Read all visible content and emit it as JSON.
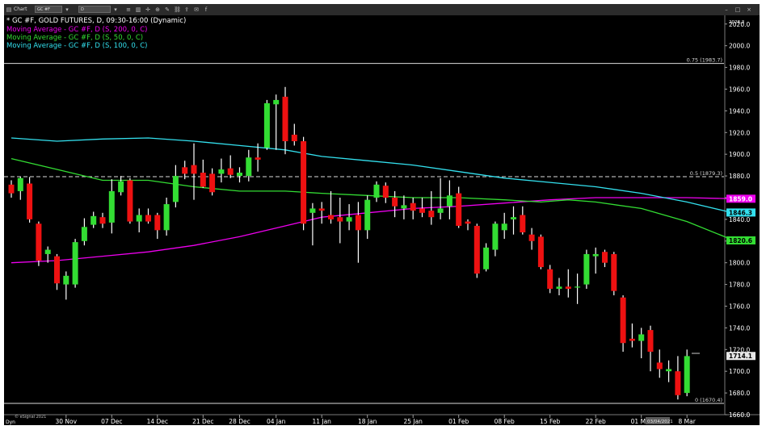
{
  "window": {
    "tab_label": "Chart",
    "symbol_field": "GC #F",
    "interval_field": "D"
  },
  "legend": {
    "main": "* GC #F, GOLD FUTURES, D, 09:30-16:00 (Dynamic)",
    "ma200": "Moving Average - GC #F, D (S, 200, 0, C)",
    "ma50": "Moving Average - GC #F, D (S, 50, 0, C)",
    "ma100": "Moving Average - GC #F, D (S, 100, 0, C)"
  },
  "footer": {
    "copyright": "© eSignal 2021",
    "dyn_label": "Dyn",
    "cursor_date": "03/04/2021"
  },
  "fib_labels": {
    "top": "0.75 (1983.7)",
    "mid": "0.5 (1879.3)",
    "bottom": "0 (1670.4)"
  },
  "price_tags": {
    "ma200": "1859.0",
    "ma100": "1846.3",
    "ma50": "1820.6",
    "last": "1714.1"
  },
  "colors": {
    "background": "#000000",
    "up_candle": "#33dd33",
    "down_candle": "#ee1111",
    "ma200": "#ee00ee",
    "ma50": "#33dd33",
    "ma100": "#33e0ee",
    "fib_line": "#dddddd",
    "axis_text": "#ffffff"
  },
  "chart_data": {
    "type": "candlestick",
    "title": "* GC #F, GOLD FUTURES, D, 09:30-16:00 (Dynamic)",
    "y_axis": {
      "min": 1660,
      "max": 2028,
      "ticks": [
        2020.0,
        2000.0,
        1980.0,
        1960.0,
        1940.0,
        1920.0,
        1900.0,
        1880.0,
        1860.0,
        1840.0,
        1820.0,
        1800.0,
        1780.0,
        1760.0,
        1740.0,
        1720.0,
        1700.0,
        1680.0,
        1660.0
      ],
      "top_label": "2028.3"
    },
    "x_ticks": [
      {
        "label": "30 Nov",
        "bar": 6
      },
      {
        "label": "07 Dec",
        "bar": 11
      },
      {
        "label": "14 Dec",
        "bar": 16
      },
      {
        "label": "21 Dec",
        "bar": 21
      },
      {
        "label": "28 Dec",
        "bar": 25
      },
      {
        "label": "04 Jan",
        "bar": 29
      },
      {
        "label": "11 Jan",
        "bar": 34
      },
      {
        "label": "18 Jan",
        "bar": 39
      },
      {
        "label": "25 Jan",
        "bar": 44
      },
      {
        "label": "01 Feb",
        "bar": 49
      },
      {
        "label": "08 Feb",
        "bar": 54
      },
      {
        "label": "15 Feb",
        "bar": 59
      },
      {
        "label": "22 Feb",
        "bar": 64
      },
      {
        "label": "01 Mar",
        "bar": 69
      },
      {
        "label": "8 Mar",
        "bar": 74
      }
    ],
    "candles": [
      {
        "o": 1872,
        "h": 1876,
        "l": 1860,
        "c": 1864
      },
      {
        "o": 1866,
        "h": 1879,
        "l": 1858,
        "c": 1878
      },
      {
        "o": 1873,
        "h": 1879,
        "l": 1837,
        "c": 1840
      },
      {
        "o": 1836,
        "h": 1838,
        "l": 1797,
        "c": 1802
      },
      {
        "o": 1808,
        "h": 1815,
        "l": 1800,
        "c": 1812
      },
      {
        "o": 1806,
        "h": 1808,
        "l": 1775,
        "c": 1781
      },
      {
        "o": 1780,
        "h": 1792,
        "l": 1766,
        "c": 1788
      },
      {
        "o": 1780,
        "h": 1822,
        "l": 1777,
        "c": 1819
      },
      {
        "o": 1820,
        "h": 1841,
        "l": 1816,
        "c": 1833
      },
      {
        "o": 1835,
        "h": 1847,
        "l": 1832,
        "c": 1843
      },
      {
        "o": 1842,
        "h": 1846,
        "l": 1832,
        "c": 1836
      },
      {
        "o": 1837,
        "h": 1877,
        "l": 1827,
        "c": 1866
      },
      {
        "o": 1865,
        "h": 1880,
        "l": 1862,
        "c": 1875
      },
      {
        "o": 1876,
        "h": 1878,
        "l": 1836,
        "c": 1838
      },
      {
        "o": 1838,
        "h": 1850,
        "l": 1828,
        "c": 1844
      },
      {
        "o": 1844,
        "h": 1850,
        "l": 1836,
        "c": 1838
      },
      {
        "o": 1844,
        "h": 1846,
        "l": 1822,
        "c": 1830
      },
      {
        "o": 1830,
        "h": 1860,
        "l": 1825,
        "c": 1854
      },
      {
        "o": 1856,
        "h": 1890,
        "l": 1851,
        "c": 1880
      },
      {
        "o": 1888,
        "h": 1894,
        "l": 1877,
        "c": 1882
      },
      {
        "o": 1890,
        "h": 1910,
        "l": 1858,
        "c": 1882
      },
      {
        "o": 1883,
        "h": 1895,
        "l": 1869,
        "c": 1870
      },
      {
        "o": 1882,
        "h": 1887,
        "l": 1862,
        "c": 1865
      },
      {
        "o": 1882,
        "h": 1896,
        "l": 1874,
        "c": 1886
      },
      {
        "o": 1887,
        "h": 1899,
        "l": 1878,
        "c": 1881
      },
      {
        "o": 1880,
        "h": 1888,
        "l": 1874,
        "c": 1883
      },
      {
        "o": 1880,
        "h": 1904,
        "l": 1875,
        "c": 1897
      },
      {
        "o": 1897,
        "h": 1910,
        "l": 1884,
        "c": 1895
      },
      {
        "o": 1906,
        "h": 1950,
        "l": 1904,
        "c": 1947
      },
      {
        "o": 1946,
        "h": 1955,
        "l": 1904,
        "c": 1950
      },
      {
        "o": 1953,
        "h": 1962,
        "l": 1900,
        "c": 1912
      },
      {
        "o": 1918,
        "h": 1928,
        "l": 1908,
        "c": 1912
      },
      {
        "o": 1912,
        "h": 1916,
        "l": 1830,
        "c": 1836
      },
      {
        "o": 1846,
        "h": 1855,
        "l": 1816,
        "c": 1850
      },
      {
        "o": 1850,
        "h": 1856,
        "l": 1836,
        "c": 1848
      },
      {
        "o": 1844,
        "h": 1866,
        "l": 1836,
        "c": 1840
      },
      {
        "o": 1842,
        "h": 1860,
        "l": 1818,
        "c": 1838
      },
      {
        "o": 1838,
        "h": 1854,
        "l": 1830,
        "c": 1842
      },
      {
        "o": 1844,
        "h": 1856,
        "l": 1800,
        "c": 1830
      },
      {
        "o": 1830,
        "h": 1862,
        "l": 1822,
        "c": 1858
      },
      {
        "o": 1860,
        "h": 1875,
        "l": 1856,
        "c": 1872
      },
      {
        "o": 1871,
        "h": 1874,
        "l": 1855,
        "c": 1860
      },
      {
        "o": 1860,
        "h": 1866,
        "l": 1842,
        "c": 1852
      },
      {
        "o": 1850,
        "h": 1862,
        "l": 1840,
        "c": 1853
      },
      {
        "o": 1855,
        "h": 1860,
        "l": 1840,
        "c": 1848
      },
      {
        "o": 1850,
        "h": 1860,
        "l": 1842,
        "c": 1846
      },
      {
        "o": 1848,
        "h": 1866,
        "l": 1835,
        "c": 1842
      },
      {
        "o": 1846,
        "h": 1878,
        "l": 1840,
        "c": 1850
      },
      {
        "o": 1852,
        "h": 1876,
        "l": 1840,
        "c": 1862
      },
      {
        "o": 1864,
        "h": 1870,
        "l": 1832,
        "c": 1834
      },
      {
        "o": 1838,
        "h": 1840,
        "l": 1830,
        "c": 1836
      },
      {
        "o": 1834,
        "h": 1836,
        "l": 1786,
        "c": 1790
      },
      {
        "o": 1794,
        "h": 1818,
        "l": 1792,
        "c": 1814
      },
      {
        "o": 1812,
        "h": 1838,
        "l": 1806,
        "c": 1836
      },
      {
        "o": 1830,
        "h": 1846,
        "l": 1822,
        "c": 1836
      },
      {
        "o": 1840,
        "h": 1852,
        "l": 1826,
        "c": 1842
      },
      {
        "o": 1844,
        "h": 1852,
        "l": 1826,
        "c": 1828
      },
      {
        "o": 1826,
        "h": 1832,
        "l": 1812,
        "c": 1820
      },
      {
        "o": 1824,
        "h": 1826,
        "l": 1794,
        "c": 1796
      },
      {
        "o": 1794,
        "h": 1798,
        "l": 1772,
        "c": 1776
      },
      {
        "o": 1776,
        "h": 1786,
        "l": 1770,
        "c": 1778
      },
      {
        "o": 1778,
        "h": 1794,
        "l": 1768,
        "c": 1776
      },
      {
        "o": 1778,
        "h": 1790,
        "l": 1762,
        "c": 1778
      },
      {
        "o": 1780,
        "h": 1812,
        "l": 1776,
        "c": 1808
      },
      {
        "o": 1806,
        "h": 1814,
        "l": 1790,
        "c": 1808
      },
      {
        "o": 1810,
        "h": 1812,
        "l": 1796,
        "c": 1800
      },
      {
        "o": 1808,
        "h": 1810,
        "l": 1770,
        "c": 1774
      },
      {
        "o": 1768,
        "h": 1770,
        "l": 1718,
        "c": 1726
      },
      {
        "o": 1730,
        "h": 1744,
        "l": 1722,
        "c": 1728
      },
      {
        "o": 1728,
        "h": 1740,
        "l": 1712,
        "c": 1734
      },
      {
        "o": 1738,
        "h": 1742,
        "l": 1700,
        "c": 1718
      },
      {
        "o": 1708,
        "h": 1720,
        "l": 1694,
        "c": 1702
      },
      {
        "o": 1700,
        "h": 1710,
        "l": 1690,
        "c": 1702
      },
      {
        "o": 1700,
        "h": 1714,
        "l": 1674,
        "c": 1678
      },
      {
        "o": 1680,
        "h": 1720,
        "l": 1677,
        "c": 1714
      }
    ],
    "moving_averages": [
      {
        "name": "Moving Average - GC #F, D (S, 200, 0, C)",
        "color": "#ee00ee",
        "points": [
          [
            0,
            1800
          ],
          [
            5,
            1802
          ],
          [
            10,
            1806
          ],
          [
            15,
            1810
          ],
          [
            20,
            1816
          ],
          [
            25,
            1824
          ],
          [
            30,
            1834
          ],
          [
            34,
            1842
          ],
          [
            39,
            1846
          ],
          [
            44,
            1850
          ],
          [
            49,
            1852
          ],
          [
            54,
            1855
          ],
          [
            59,
            1858
          ],
          [
            64,
            1860
          ],
          [
            69,
            1860
          ],
          [
            74,
            1860
          ],
          [
            79,
            1859
          ]
        ]
      },
      {
        "name": "Moving Average - GC #F, D (S, 50, 0, C)",
        "color": "#33dd33",
        "points": [
          [
            0,
            1896
          ],
          [
            5,
            1886
          ],
          [
            10,
            1876
          ],
          [
            15,
            1876
          ],
          [
            20,
            1870
          ],
          [
            25,
            1866
          ],
          [
            30,
            1866
          ],
          [
            34,
            1864
          ],
          [
            39,
            1862
          ],
          [
            44,
            1860
          ],
          [
            49,
            1860
          ],
          [
            54,
            1858
          ],
          [
            58,
            1856
          ],
          [
            61,
            1858
          ],
          [
            64,
            1856
          ],
          [
            69,
            1850
          ],
          [
            74,
            1838
          ],
          [
            79,
            1821
          ]
        ]
      },
      {
        "name": "Moving Average - GC #F, D (S, 100, 0, C)",
        "color": "#33e0ee",
        "points": [
          [
            0,
            1915
          ],
          [
            5,
            1912
          ],
          [
            10,
            1914
          ],
          [
            15,
            1915
          ],
          [
            20,
            1912
          ],
          [
            25,
            1908
          ],
          [
            30,
            1904
          ],
          [
            34,
            1898
          ],
          [
            39,
            1894
          ],
          [
            44,
            1890
          ],
          [
            49,
            1884
          ],
          [
            54,
            1878
          ],
          [
            59,
            1874
          ],
          [
            64,
            1870
          ],
          [
            69,
            1864
          ],
          [
            74,
            1856
          ],
          [
            79,
            1846
          ]
        ]
      }
    ],
    "horizontal_lines": [
      {
        "label": "0.75 (1983.7)",
        "value": 1983.7,
        "style": "solid"
      },
      {
        "label": "0.5 (1879.3)",
        "value": 1879.3,
        "style": "dashed"
      },
      {
        "label": "0 (1670.4)",
        "value": 1670.4,
        "style": "solid"
      }
    ],
    "grid": false,
    "legend_position": "top-left"
  }
}
